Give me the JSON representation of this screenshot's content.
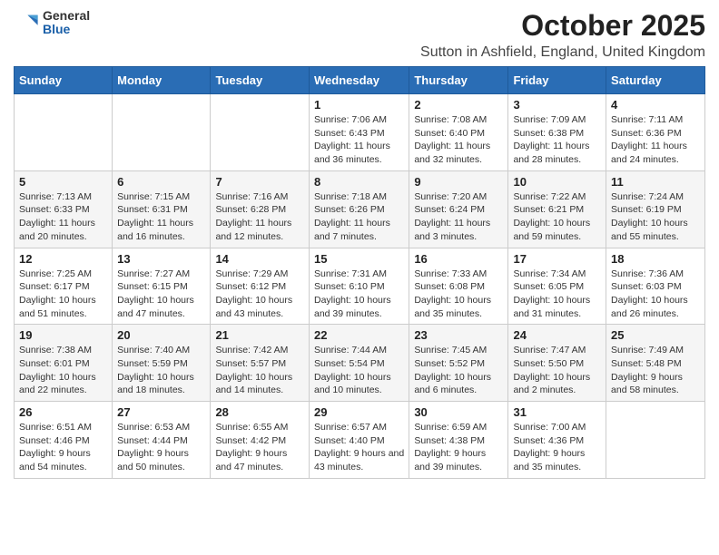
{
  "header": {
    "logo_general": "General",
    "logo_blue": "Blue",
    "month": "October 2025",
    "location": "Sutton in Ashfield, England, United Kingdom"
  },
  "days_of_week": [
    "Sunday",
    "Monday",
    "Tuesday",
    "Wednesday",
    "Thursday",
    "Friday",
    "Saturday"
  ],
  "weeks": [
    [
      {
        "day": "",
        "info": ""
      },
      {
        "day": "",
        "info": ""
      },
      {
        "day": "",
        "info": ""
      },
      {
        "day": "1",
        "info": "Sunrise: 7:06 AM\nSunset: 6:43 PM\nDaylight: 11 hours and 36 minutes."
      },
      {
        "day": "2",
        "info": "Sunrise: 7:08 AM\nSunset: 6:40 PM\nDaylight: 11 hours and 32 minutes."
      },
      {
        "day": "3",
        "info": "Sunrise: 7:09 AM\nSunset: 6:38 PM\nDaylight: 11 hours and 28 minutes."
      },
      {
        "day": "4",
        "info": "Sunrise: 7:11 AM\nSunset: 6:36 PM\nDaylight: 11 hours and 24 minutes."
      }
    ],
    [
      {
        "day": "5",
        "info": "Sunrise: 7:13 AM\nSunset: 6:33 PM\nDaylight: 11 hours and 20 minutes."
      },
      {
        "day": "6",
        "info": "Sunrise: 7:15 AM\nSunset: 6:31 PM\nDaylight: 11 hours and 16 minutes."
      },
      {
        "day": "7",
        "info": "Sunrise: 7:16 AM\nSunset: 6:28 PM\nDaylight: 11 hours and 12 minutes."
      },
      {
        "day": "8",
        "info": "Sunrise: 7:18 AM\nSunset: 6:26 PM\nDaylight: 11 hours and 7 minutes."
      },
      {
        "day": "9",
        "info": "Sunrise: 7:20 AM\nSunset: 6:24 PM\nDaylight: 11 hours and 3 minutes."
      },
      {
        "day": "10",
        "info": "Sunrise: 7:22 AM\nSunset: 6:21 PM\nDaylight: 10 hours and 59 minutes."
      },
      {
        "day": "11",
        "info": "Sunrise: 7:24 AM\nSunset: 6:19 PM\nDaylight: 10 hours and 55 minutes."
      }
    ],
    [
      {
        "day": "12",
        "info": "Sunrise: 7:25 AM\nSunset: 6:17 PM\nDaylight: 10 hours and 51 minutes."
      },
      {
        "day": "13",
        "info": "Sunrise: 7:27 AM\nSunset: 6:15 PM\nDaylight: 10 hours and 47 minutes."
      },
      {
        "day": "14",
        "info": "Sunrise: 7:29 AM\nSunset: 6:12 PM\nDaylight: 10 hours and 43 minutes."
      },
      {
        "day": "15",
        "info": "Sunrise: 7:31 AM\nSunset: 6:10 PM\nDaylight: 10 hours and 39 minutes."
      },
      {
        "day": "16",
        "info": "Sunrise: 7:33 AM\nSunset: 6:08 PM\nDaylight: 10 hours and 35 minutes."
      },
      {
        "day": "17",
        "info": "Sunrise: 7:34 AM\nSunset: 6:05 PM\nDaylight: 10 hours and 31 minutes."
      },
      {
        "day": "18",
        "info": "Sunrise: 7:36 AM\nSunset: 6:03 PM\nDaylight: 10 hours and 26 minutes."
      }
    ],
    [
      {
        "day": "19",
        "info": "Sunrise: 7:38 AM\nSunset: 6:01 PM\nDaylight: 10 hours and 22 minutes."
      },
      {
        "day": "20",
        "info": "Sunrise: 7:40 AM\nSunset: 5:59 PM\nDaylight: 10 hours and 18 minutes."
      },
      {
        "day": "21",
        "info": "Sunrise: 7:42 AM\nSunset: 5:57 PM\nDaylight: 10 hours and 14 minutes."
      },
      {
        "day": "22",
        "info": "Sunrise: 7:44 AM\nSunset: 5:54 PM\nDaylight: 10 hours and 10 minutes."
      },
      {
        "day": "23",
        "info": "Sunrise: 7:45 AM\nSunset: 5:52 PM\nDaylight: 10 hours and 6 minutes."
      },
      {
        "day": "24",
        "info": "Sunrise: 7:47 AM\nSunset: 5:50 PM\nDaylight: 10 hours and 2 minutes."
      },
      {
        "day": "25",
        "info": "Sunrise: 7:49 AM\nSunset: 5:48 PM\nDaylight: 9 hours and 58 minutes."
      }
    ],
    [
      {
        "day": "26",
        "info": "Sunrise: 6:51 AM\nSunset: 4:46 PM\nDaylight: 9 hours and 54 minutes."
      },
      {
        "day": "27",
        "info": "Sunrise: 6:53 AM\nSunset: 4:44 PM\nDaylight: 9 hours and 50 minutes."
      },
      {
        "day": "28",
        "info": "Sunrise: 6:55 AM\nSunset: 4:42 PM\nDaylight: 9 hours and 47 minutes."
      },
      {
        "day": "29",
        "info": "Sunrise: 6:57 AM\nSunset: 4:40 PM\nDaylight: 9 hours and 43 minutes."
      },
      {
        "day": "30",
        "info": "Sunrise: 6:59 AM\nSunset: 4:38 PM\nDaylight: 9 hours and 39 minutes."
      },
      {
        "day": "31",
        "info": "Sunrise: 7:00 AM\nSunset: 4:36 PM\nDaylight: 9 hours and 35 minutes."
      },
      {
        "day": "",
        "info": ""
      }
    ]
  ]
}
